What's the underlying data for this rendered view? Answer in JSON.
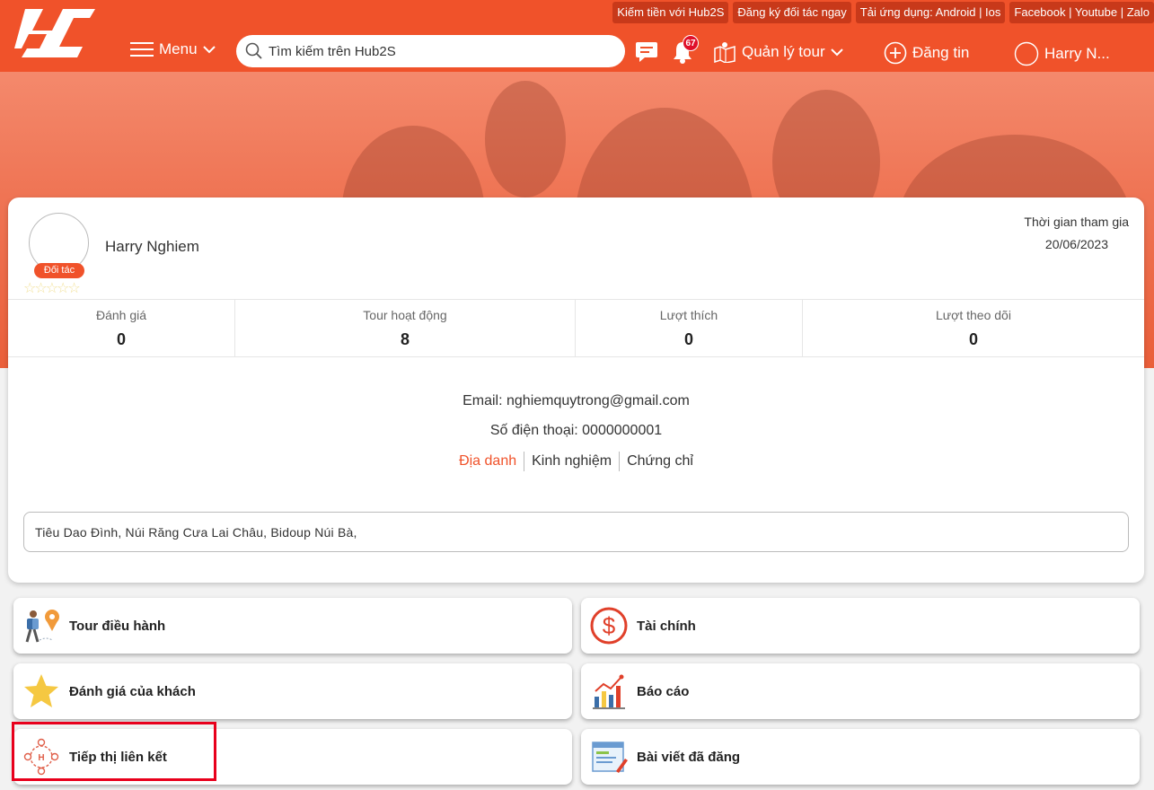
{
  "header": {
    "brand_icon": "hub2s-logo",
    "top_links": [
      "Kiếm tiền với Hub2S",
      "Đăng ký đối tác ngay",
      "Tải ứng dụng:  Android | Ios",
      "Facebook | Youtube | Zalo"
    ],
    "menu_label": "Menu",
    "search_placeholder": "Tìm kiếm trên Hub2S",
    "notification_count": "67",
    "tour_manage_label": "Quản lý tour",
    "post_label": "Đăng tin",
    "user_label": "Harry N..."
  },
  "banner_icons": [
    "help-icon",
    "settings-icon",
    "cart-icon"
  ],
  "profile": {
    "name": "Harry Nghiem",
    "role_badge": "Đối tác",
    "join_label": "Thời gian tham gia",
    "join_date": "20/06/2023",
    "rating_stars": 0,
    "stats": [
      {
        "label": "Đánh giá",
        "value": "0"
      },
      {
        "label": "Tour hoạt động",
        "value": "8"
      },
      {
        "label": "Lượt thích",
        "value": "0"
      },
      {
        "label": "Lượt theo dõi",
        "value": "0"
      }
    ],
    "email": "Email: nghiemquytrong@gmail.com",
    "phone": "Số điện thoại: 0000000001",
    "tabs": [
      "Địa danh",
      "Kinh nghiệm",
      "Chứng chỉ"
    ],
    "active_tab": "Địa danh",
    "places": "Tiêu Dao Đình, Núi Răng Cưa Lai Châu, Bidoup Núi Bà,"
  },
  "menu_tiles": [
    {
      "label": "Tour điều hành",
      "icon": "tour-guide-icon"
    },
    {
      "label": "Tài chính",
      "icon": "finance-icon"
    },
    {
      "label": "Đánh giá của khách",
      "icon": "star-icon"
    },
    {
      "label": "Báo cáo",
      "icon": "report-chart-icon"
    },
    {
      "label": "Tiếp thị liên kết",
      "icon": "affiliate-icon"
    },
    {
      "label": "Bài viết đã đăng",
      "icon": "posted-articles-icon"
    }
  ],
  "colors": {
    "brand": "#f0522a",
    "highlight": "#e8001c"
  }
}
